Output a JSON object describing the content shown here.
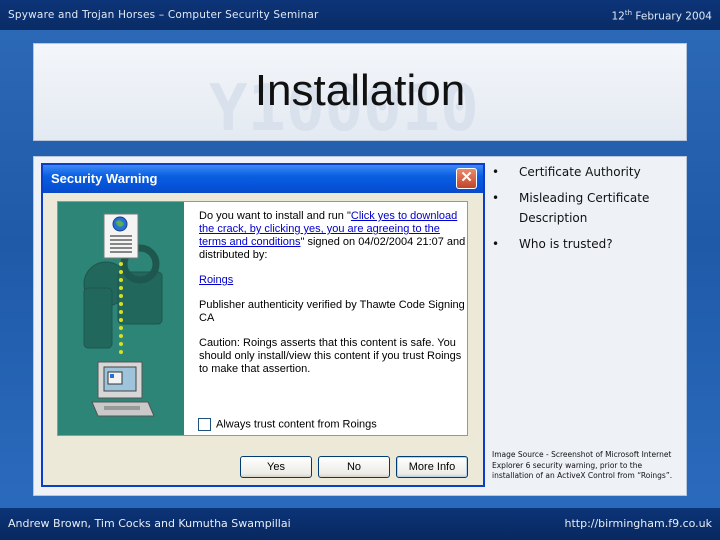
{
  "slide": {
    "header_left": "Spyware and Trojan Horses – Computer Security Seminar",
    "header_date_day": "12",
    "header_date_suffix": "th",
    "header_date_rest": " February 2004",
    "title": "Installation",
    "watermark": "Y100010",
    "bullets": [
      "Certificate Authority",
      "Misleading Certificate Description",
      "Who is trusted?"
    ],
    "image_source": "Image Source - Screenshot of Microsoft Internet Explorer 6 security warning, prior to the installation of an ActiveX Control from “Roings”.",
    "footer_left": "Andrew Brown, Tim Cocks and Kumutha Swampillai",
    "footer_right": "http://birmingham.f9.co.uk"
  },
  "dialog": {
    "title": "Security Warning",
    "close_glyph": "✕",
    "prompt_before": "Do you want to install and run \"",
    "prompt_link": "Click yes to download the crack, by clicking yes, you are agreeing to the terms and conditions",
    "prompt_after": "\" signed on 04/02/2004 21:07 and distributed by:",
    "publisher_link": "Roings",
    "authenticity": "Publisher authenticity verified by Thawte Code Signing CA",
    "caution": "Caution: Roings asserts that this content is safe.  You should only install/view this content if you trust Roings to make that assertion.",
    "checkbox_label": "Always trust content from Roings",
    "checkbox_checked": false,
    "buttons": {
      "yes": "Yes",
      "no": "No",
      "more": "More Info"
    },
    "colors": {
      "titlebar": "#0551d8",
      "sidebar": "#2d8578",
      "link": "#0000cc"
    }
  }
}
